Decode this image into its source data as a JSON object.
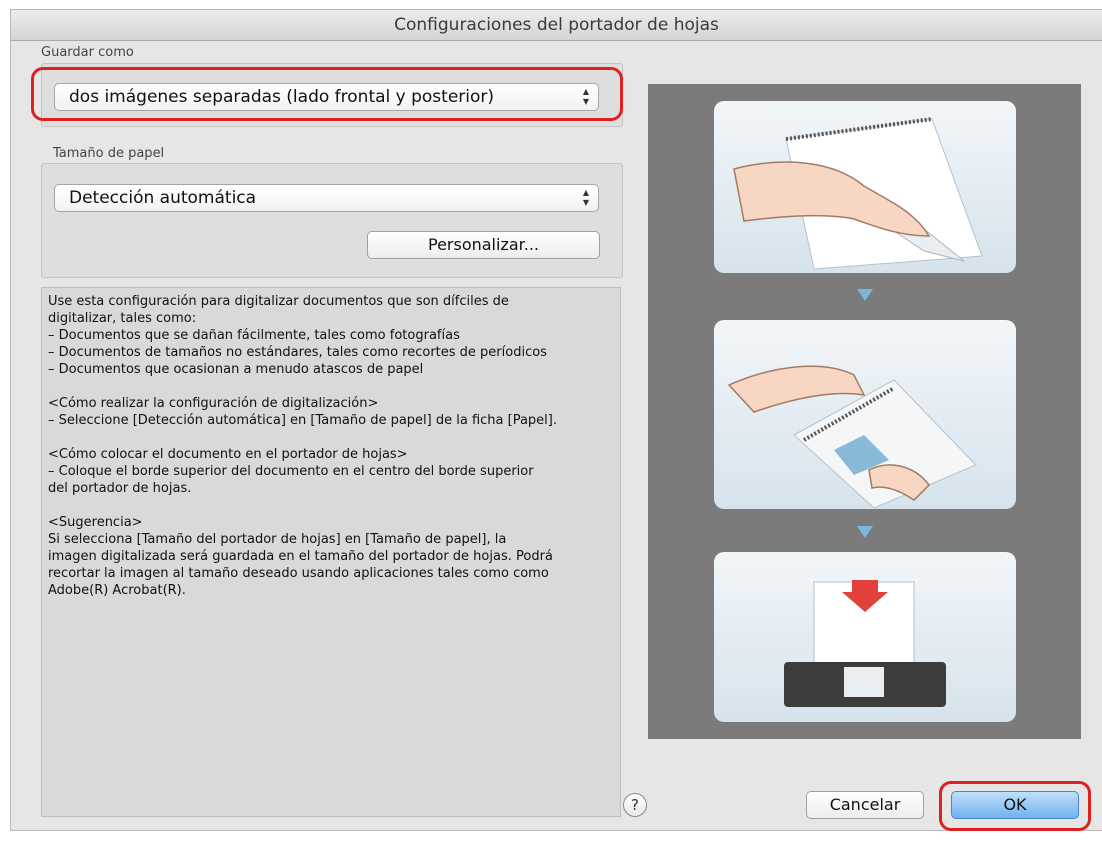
{
  "window": {
    "title": "Configuraciones del portador de hojas"
  },
  "save_as": {
    "label": "Guardar como",
    "selected": "dos imágenes separadas (lado frontal y posterior)"
  },
  "paper_size": {
    "label": "Tamaño de papel",
    "selected": "Detección automática",
    "customize_label": "Personalizar..."
  },
  "description": {
    "intro": "Use esta configuración para digitalizar documentos que son dífciles de\ndigitalizar, tales como:\n– Documentos que se dañan fácilmente, tales como fotografías\n– Documentos de tamaños no estándares, tales como recortes de períodicos\n– Documentos que ocasionan a menudo atascos de papel",
    "scan_settings": "<Cómo realizar la configuración de digitalización>\n– Seleccione [Detección automática] en [Tamaño de papel] de la ficha [Papel].",
    "placement": "<Cómo colocar el documento en el portador de hojas>\n– Coloque el borde superior del documento en el centro del borde superior\ndel portador de hojas.",
    "tip": "<Sugerencia>\nSi selecciona [Tamaño del portador de hojas] en [Tamaño de papel], la\nimagen digitalizada será guardada en el tamaño del portador de hojas. Podrá\nrecortar la imagen al tamaño deseado usando aplicaciones tales como como\nAdobe(R) Acrobat(R)."
  },
  "buttons": {
    "help": "?",
    "cancel": "Cancelar",
    "ok": "OK"
  },
  "icons": {
    "select_arrows": "up-down-arrows-icon",
    "help": "question-mark-icon"
  },
  "colors": {
    "highlight": "#e02020",
    "ok_button": "#6fb2ee",
    "step_arrow": "#7ab8e0"
  }
}
